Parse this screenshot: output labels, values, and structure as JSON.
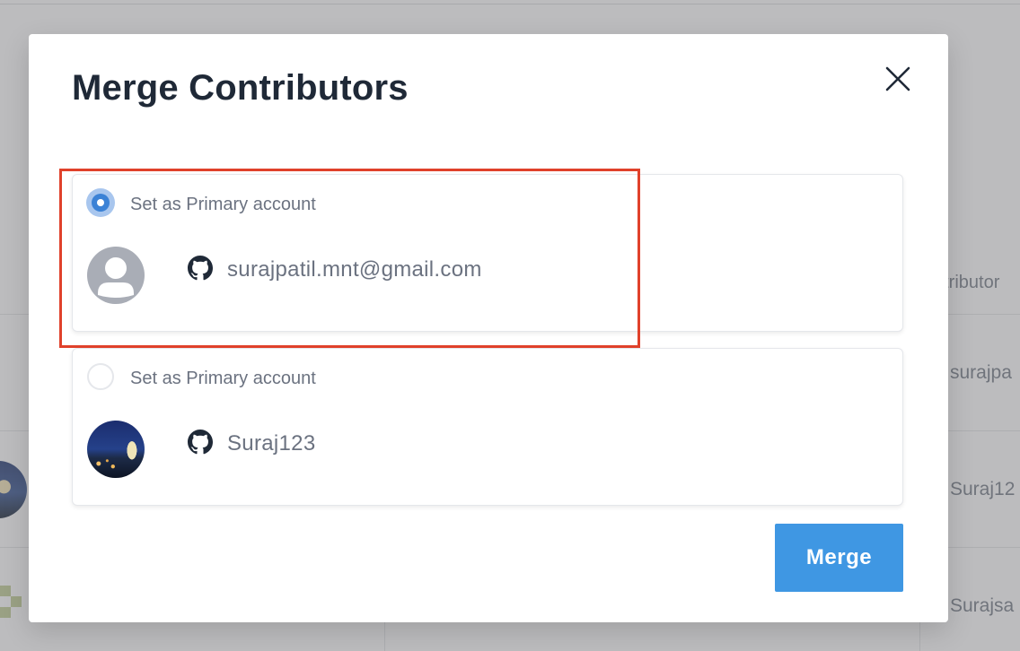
{
  "background": {
    "column_header": "ntributor",
    "rows": [
      "surajpa",
      "Suraj12",
      "Surajsa"
    ]
  },
  "modal": {
    "title": "Merge Contributors",
    "close_icon": "close-icon",
    "accounts": [
      {
        "radio_label": "Set as Primary account",
        "selected": true,
        "avatar": "default-avatar",
        "provider_icon": "github-icon",
        "name": "surajpatil.mnt@gmail.com"
      },
      {
        "radio_label": "Set as Primary account",
        "selected": false,
        "avatar": "photo-avatar",
        "provider_icon": "github-icon",
        "name": "Suraj123"
      }
    ],
    "merge_label": "Merge"
  },
  "colors": {
    "accent": "#3f97e3",
    "radio_selected": "#3b82d6",
    "highlight": "#e0412b",
    "title": "#1f2937",
    "muted_text": "#6b7280"
  }
}
